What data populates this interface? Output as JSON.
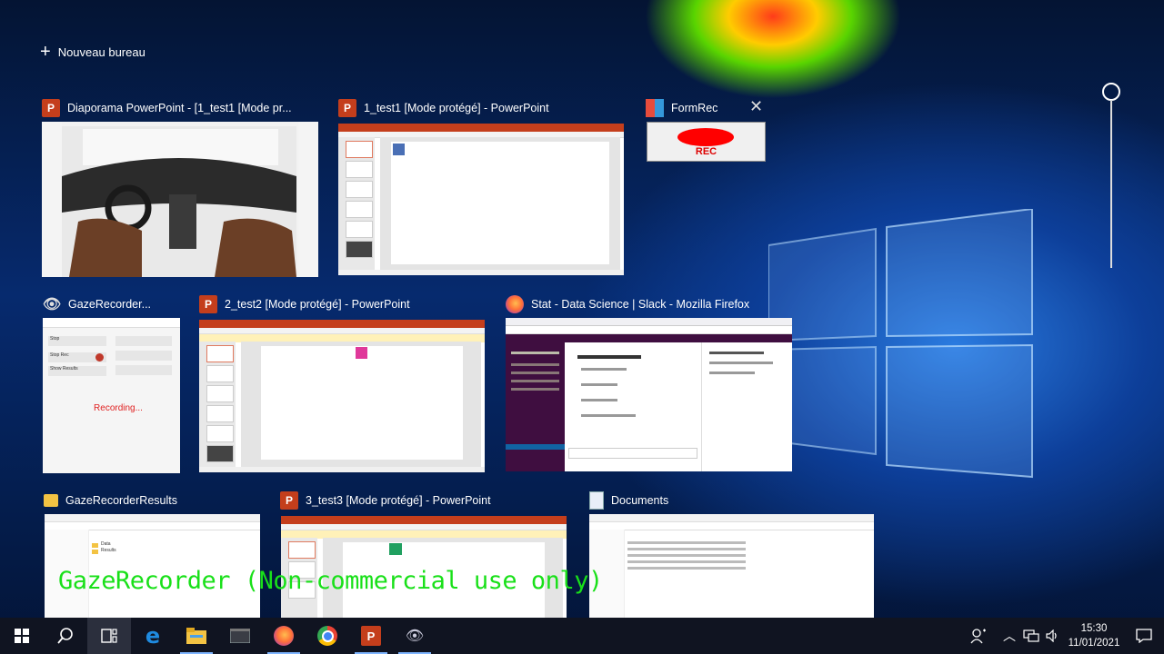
{
  "new_desktop": {
    "label": "Nouveau bureau"
  },
  "windows": {
    "w1": {
      "title": "Diaporama PowerPoint - [1_test1 [Mode pr..."
    },
    "w2": {
      "title": "1_test1 [Mode protégé] - PowerPoint"
    },
    "w3": {
      "title": "FormRec",
      "rec_label": "REC"
    },
    "w4": {
      "title": "GazeRecorder...",
      "recording_label": "Recording...",
      "buttons": [
        "Stop",
        "Stop Rec",
        "Show Results"
      ]
    },
    "w5": {
      "title": "2_test2 [Mode protégé] - PowerPoint"
    },
    "w6": {
      "title": "Stat - Data Science | Slack - Mozilla Firefox"
    },
    "w7": {
      "title": "GazeRecorderResults",
      "items": [
        "Data",
        "Results"
      ]
    },
    "w8": {
      "title": "3_test3 [Mode protégé] - PowerPoint"
    },
    "w9": {
      "title": "Documents"
    }
  },
  "watermark": "GazeRecorder (Non-commercial use only)",
  "taskbar": {
    "items": [
      "start-icon",
      "search-icon",
      "task-view-icon",
      "edge-icon",
      "file-explorer-icon",
      "terminal-icon",
      "firefox-icon",
      "chrome-icon",
      "powerpoint-icon",
      "gazerecorder-icon"
    ],
    "time": "15:30",
    "date": "11/01/2021"
  },
  "colors": {
    "powerpoint": "#c43e1c",
    "watermark": "#19e019",
    "taskbar": "#101421"
  }
}
